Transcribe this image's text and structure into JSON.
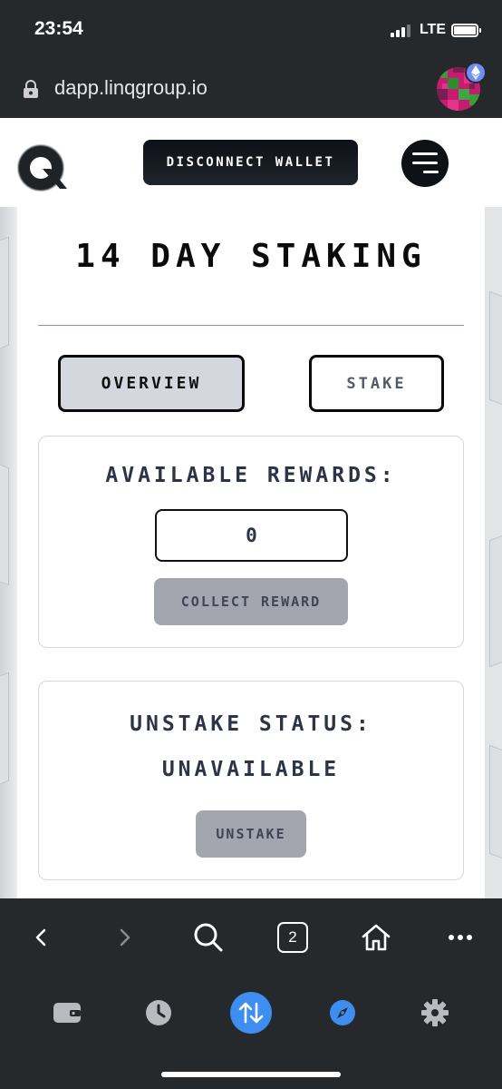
{
  "status_bar": {
    "time": "23:54",
    "network": "LTE",
    "signal_bars_active": 3,
    "signal_bars_total": 4,
    "battery_level": 1.0
  },
  "browser": {
    "url": "dapp.linqgroup.io",
    "open_tabs_count": "2",
    "nav_icons": [
      "back-icon",
      "forward-icon",
      "search-icon",
      "tabs-icon",
      "home-icon",
      "more-icon"
    ],
    "dock_icons": [
      "wallet-icon",
      "history-icon",
      "swap-icon",
      "discover-icon",
      "settings-icon"
    ],
    "accent_color": "#3d8ef0"
  },
  "header": {
    "logo": "linq-q-logo",
    "disconnect_label": "DISCONNECT WALLET",
    "menu_icon": "menu-icon"
  },
  "page": {
    "title": "14 DAY STAKING",
    "tabs": [
      {
        "label": "OVERVIEW",
        "active": true
      },
      {
        "label": "STAKE",
        "active": false
      }
    ],
    "rewards": {
      "title": "AVAILABLE REWARDS:",
      "value": "0",
      "button_label": "COLLECT REWARD"
    },
    "unstake": {
      "title": "UNSTAKE STATUS:",
      "status": "UNAVAILABLE",
      "button_label": "UNSTAKE"
    }
  }
}
